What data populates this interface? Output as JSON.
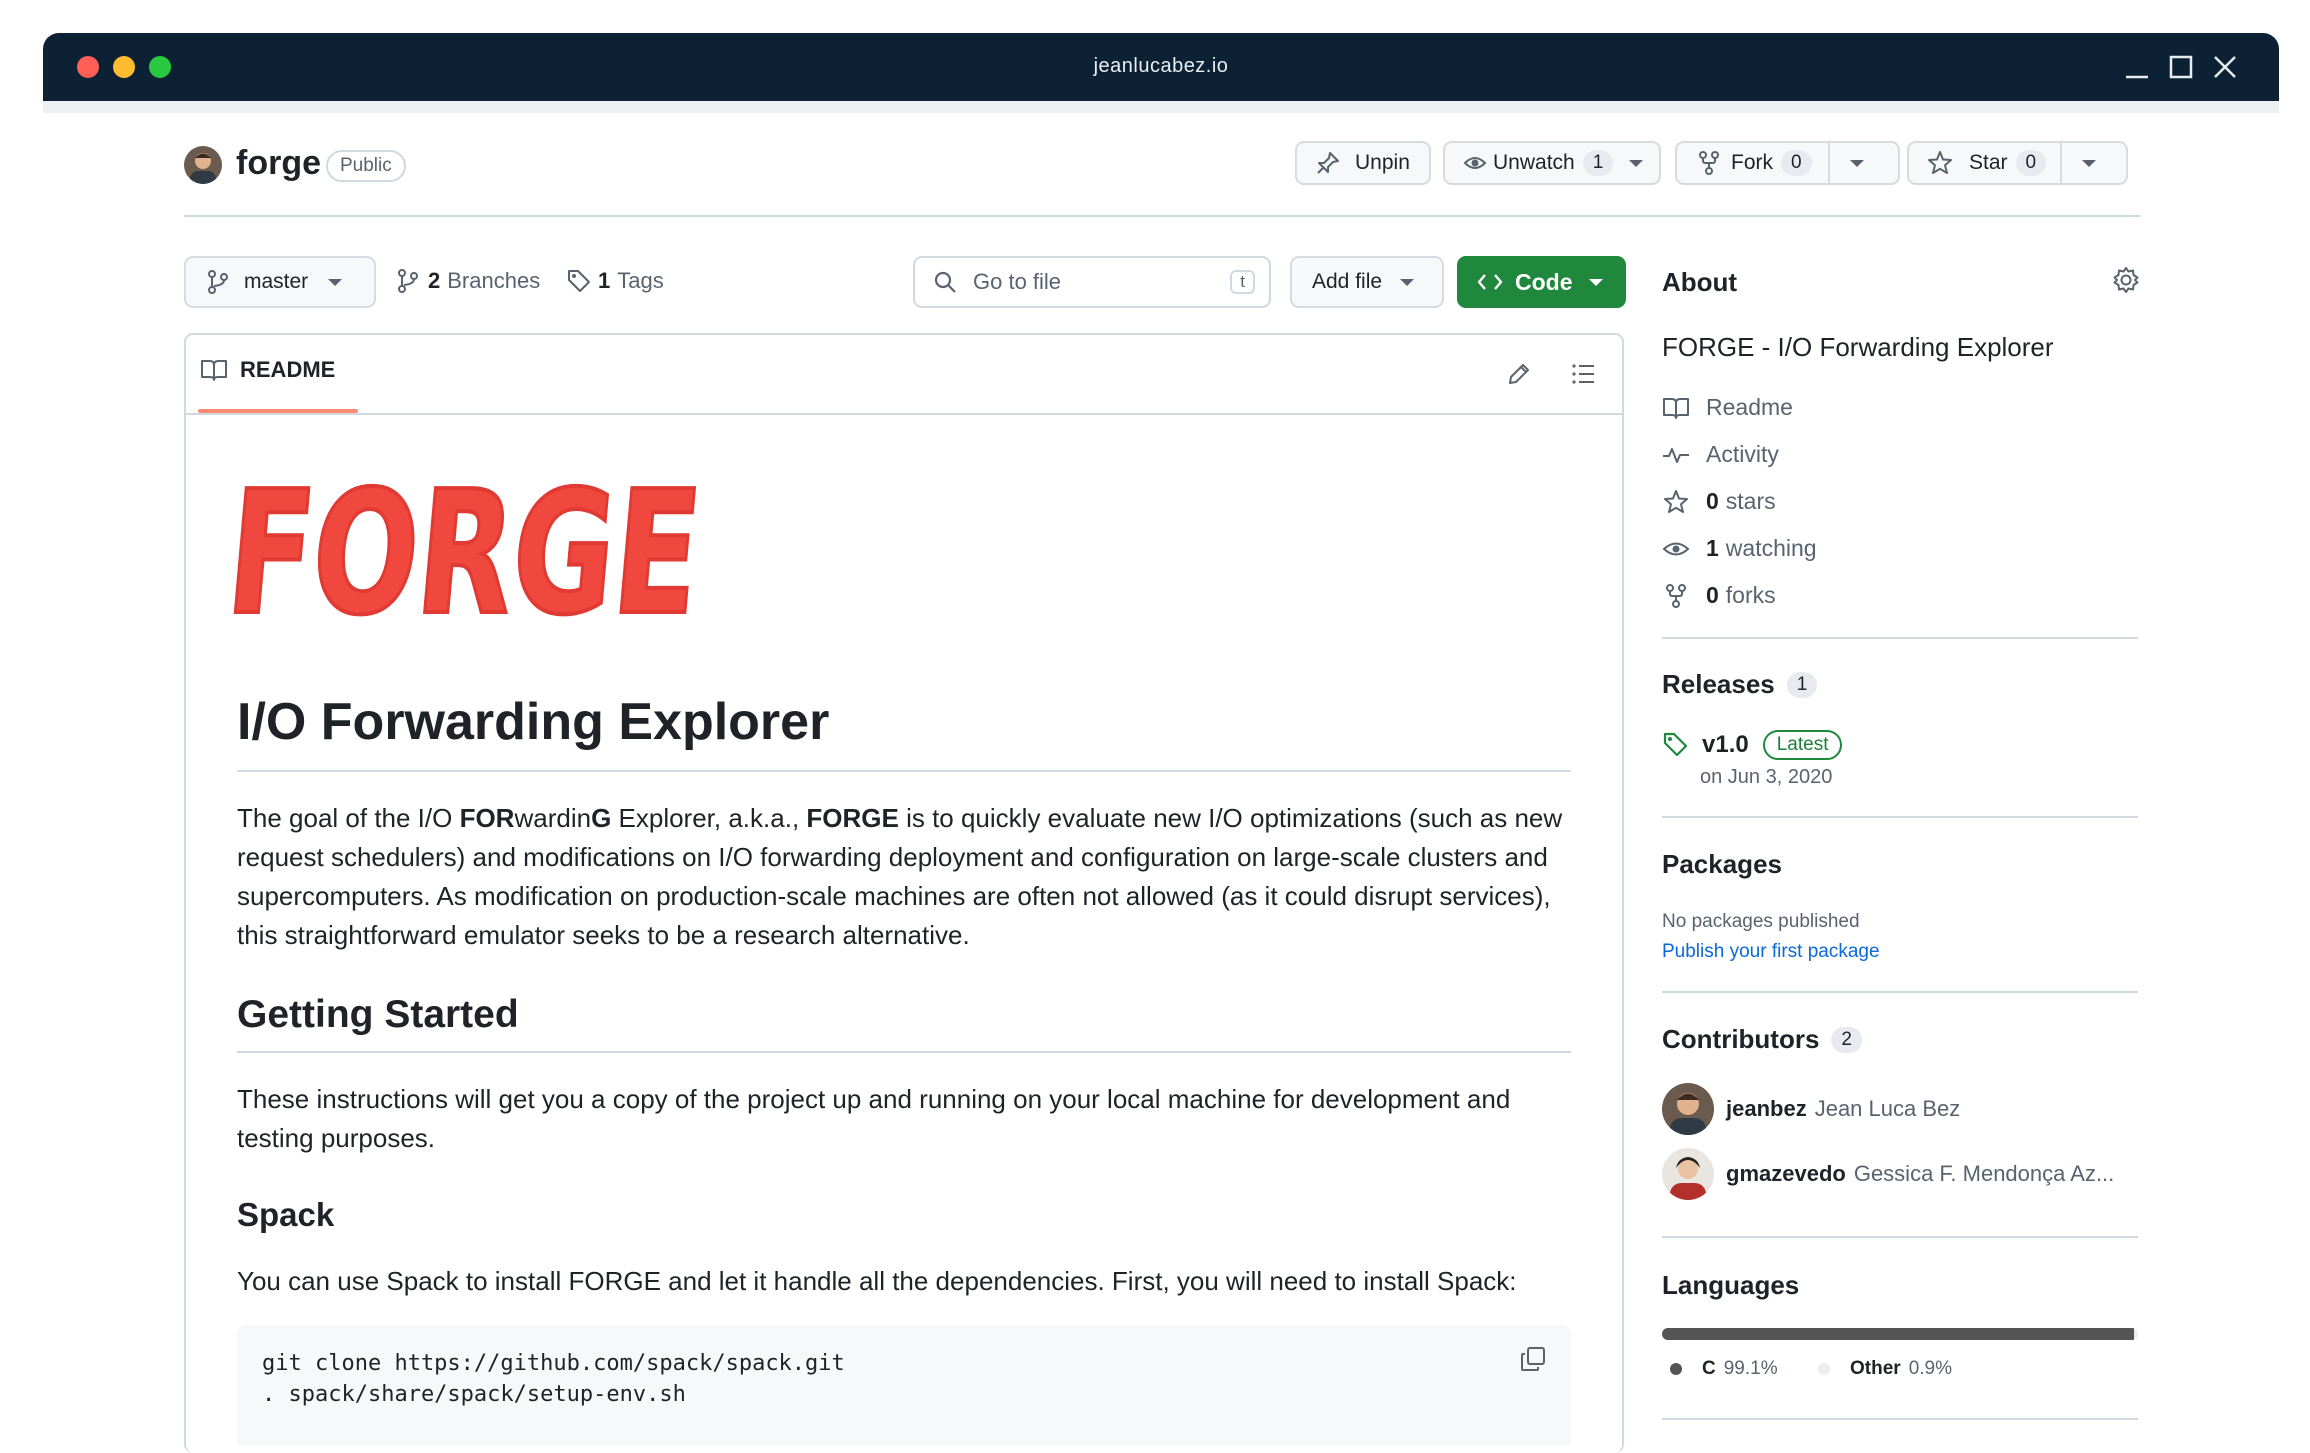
{
  "window": {
    "title": "jeanlucabez.io",
    "colors": {
      "titlebar": "#0c2234",
      "close": "#fe5f57",
      "minimize": "#febc2e",
      "maximize": "#28c840"
    }
  },
  "repo": {
    "name": "forge",
    "visibility": "Public",
    "actions": {
      "unpin": "Unpin",
      "unwatch": "Unwatch",
      "watch_count": "1",
      "fork": "Fork",
      "fork_count": "0",
      "star": "Star",
      "star_count": "0"
    }
  },
  "toolbar": {
    "branch": "master",
    "branches_count": "2",
    "branches_label": "Branches",
    "tags_count": "1",
    "tags_label": "Tags",
    "goto_placeholder": "Go to file",
    "goto_shortcut": "t",
    "add_file": "Add file",
    "code": "Code",
    "code_color": "#1f883d"
  },
  "readme": {
    "tab": "README",
    "logo_text": "FORGE",
    "logo_color": "#f0473f",
    "title": "I/O Forwarding Explorer",
    "intro": {
      "t1": "The goal of the I/O ",
      "b1": "FOR",
      "t2": "wardin",
      "b2": "G",
      "t3": " Explorer, a.k.a., ",
      "b3": "FORGE",
      "t4": " is to quickly evaluate new I/O optimizations (such as new request schedulers) and modifications on I/O forwarding deployment and configuration on large-scale clusters and supercomputers. As modification on production-scale machines are often not allowed (as it could disrupt services), this straightforward emulator seeks to be a research alternative."
    },
    "getting_started_heading": "Getting Started",
    "getting_started_text": "These instructions will get you a copy of the project up and running on your local machine for development and testing purposes.",
    "spack_heading": "Spack",
    "spack_text": "You can use Spack to install FORGE and let it handle all the dependencies. First, you will need to install Spack:",
    "code_lines": [
      "git clone https://github.com/spack/spack.git",
      ". spack/share/spack/setup-env.sh"
    ]
  },
  "about": {
    "heading": "About",
    "description": "FORGE - I/O Forwarding Explorer",
    "readme": "Readme",
    "activity": "Activity",
    "stars_count": "0",
    "stars_label": "stars",
    "watching_count": "1",
    "watching_label": "watching",
    "forks_count": "0",
    "forks_label": "forks"
  },
  "releases": {
    "heading": "Releases",
    "count": "1",
    "version": "v1.0",
    "badge": "Latest",
    "date": "on Jun 3, 2020"
  },
  "packages": {
    "heading": "Packages",
    "empty": "No packages published",
    "link": "Publish your first package"
  },
  "contributors": {
    "heading": "Contributors",
    "count": "2",
    "list": [
      {
        "login": "jeanbez",
        "name": "Jean Luca Bez"
      },
      {
        "login": "gmazevedo",
        "name": "Gessica F. Mendonça Az..."
      }
    ]
  },
  "languages": {
    "heading": "Languages",
    "items": [
      {
        "name": "C",
        "percent": "99.1%",
        "value": 99.1,
        "color": "#555555"
      },
      {
        "name": "Other",
        "percent": "0.9%",
        "value": 0.9,
        "color": "#ededed"
      }
    ]
  }
}
